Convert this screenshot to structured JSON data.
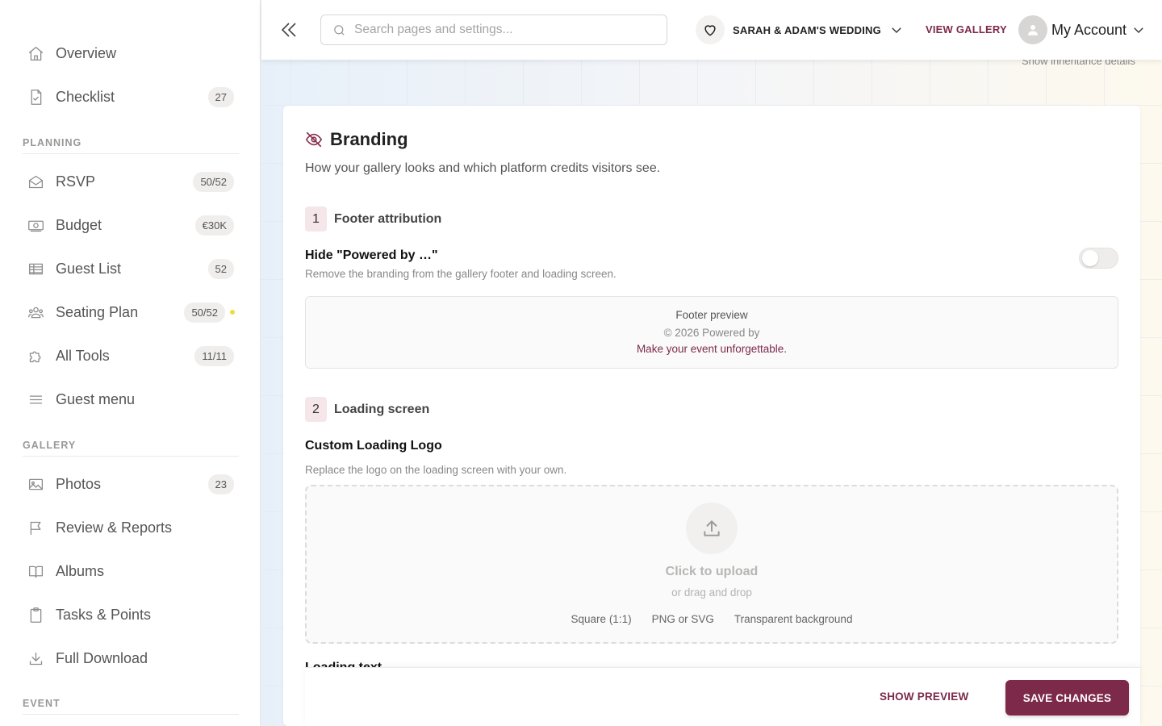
{
  "sidebar": {
    "items_top": [
      {
        "label": "Overview",
        "badge": "",
        "icon": "home-icon"
      },
      {
        "label": "Checklist",
        "badge": "27",
        "icon": "checklist-icon"
      }
    ],
    "sections": {
      "planning": "PLANNING",
      "gallery": "GALLERY",
      "event": "EVENT"
    },
    "planning_items": [
      {
        "label": "RSVP",
        "badge": "50/52",
        "icon": "envelope-icon"
      },
      {
        "label": "Budget",
        "badge": "€30K",
        "icon": "money-icon"
      },
      {
        "label": "Guest List",
        "badge": "52",
        "icon": "table-icon"
      },
      {
        "label": "Seating Plan",
        "badge": "50/52",
        "icon": "people-icon",
        "dot": true
      },
      {
        "label": "All Tools",
        "badge": "11/11",
        "icon": "puzzle-icon"
      },
      {
        "label": "Guest menu",
        "badge": "",
        "icon": "menu-icon"
      }
    ],
    "gallery_items": [
      {
        "label": "Photos",
        "badge": "23",
        "icon": "image-icon"
      },
      {
        "label": "Review & Reports",
        "badge": "",
        "icon": "flag-icon"
      },
      {
        "label": "Albums",
        "badge": "",
        "icon": "book-icon"
      },
      {
        "label": "Tasks & Points",
        "badge": "",
        "icon": "clipboard-icon"
      },
      {
        "label": "Full Download",
        "badge": "",
        "icon": "download-icon"
      }
    ]
  },
  "topbar": {
    "search_placeholder": "Search pages and settings...",
    "event_name": "SARAH & ADAM'S WEDDING",
    "view_gallery": "VIEW GALLERY",
    "account": "My Account"
  },
  "inherit_link": "Show inheritance details",
  "card": {
    "title": "Branding",
    "subtitle": "How your gallery looks and which platform credits visitors see.",
    "step1": {
      "num": "1",
      "title": "Footer attribution"
    },
    "hide_powered": {
      "title": "Hide \"Powered by …\"",
      "help": "Remove the branding from the gallery footer and loading screen.",
      "enabled": false
    },
    "footer_preview": {
      "title": "Footer preview",
      "copy": "© 2026 Powered by",
      "tagline": "Make your event unforgettable."
    },
    "step2": {
      "num": "2",
      "title": "Loading screen"
    },
    "custom_logo": {
      "title": "Custom Loading Logo",
      "help": "Replace the logo on the loading screen with your own."
    },
    "upload": {
      "main": "Click to upload",
      "sub": "or drag and drop",
      "specs": [
        "Square (1:1)",
        "PNG or SVG",
        "Transparent background"
      ]
    },
    "loading_text_label": "Loading text"
  },
  "actions": {
    "preview": "SHOW PREVIEW",
    "save": "SAVE CHANGES"
  },
  "colors": {
    "accent": "#7d2a4a",
    "badge_dot": "#f2dc3b"
  }
}
